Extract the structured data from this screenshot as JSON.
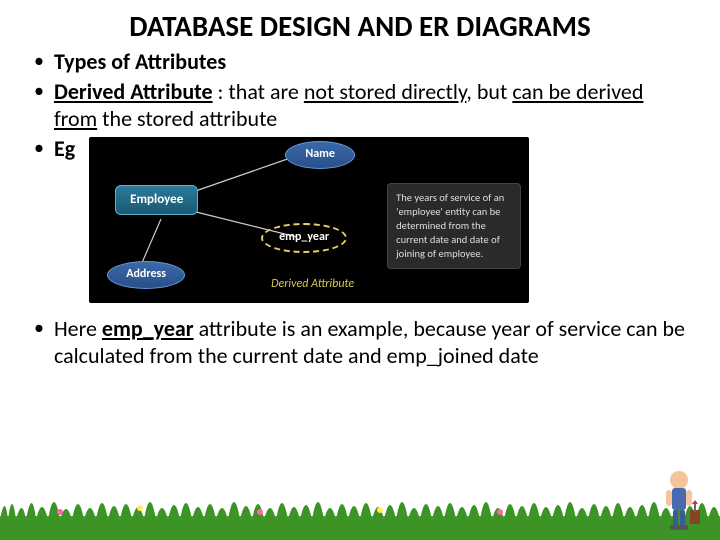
{
  "title": "DATABASE DESIGN AND ER DIAGRAMS",
  "bullets": {
    "b1_bold": "Types of Attributes",
    "b2_boldu": "Derived Attribute",
    "b2_plain1": " : that are ",
    "b2_u1": "not stored directly",
    "b2_plain2": ", but ",
    "b2_u2": "can be derived from",
    "b2_plain3": " the stored attribute",
    "b3": "Eg",
    "b4_pre": "Here ",
    "b4_boldu": "emp_year",
    "b4_post": " attribute is an example, because year of service can be calculated from the current date and emp_joined date"
  },
  "diagram": {
    "entity": "Employee",
    "attr_name": "Name",
    "attr_address": "Address",
    "derived": "emp_year",
    "caption": "Derived Attribute",
    "sidebox": "The years of service of an 'employee' entity can be determined from the current date and date of joining of employee."
  }
}
